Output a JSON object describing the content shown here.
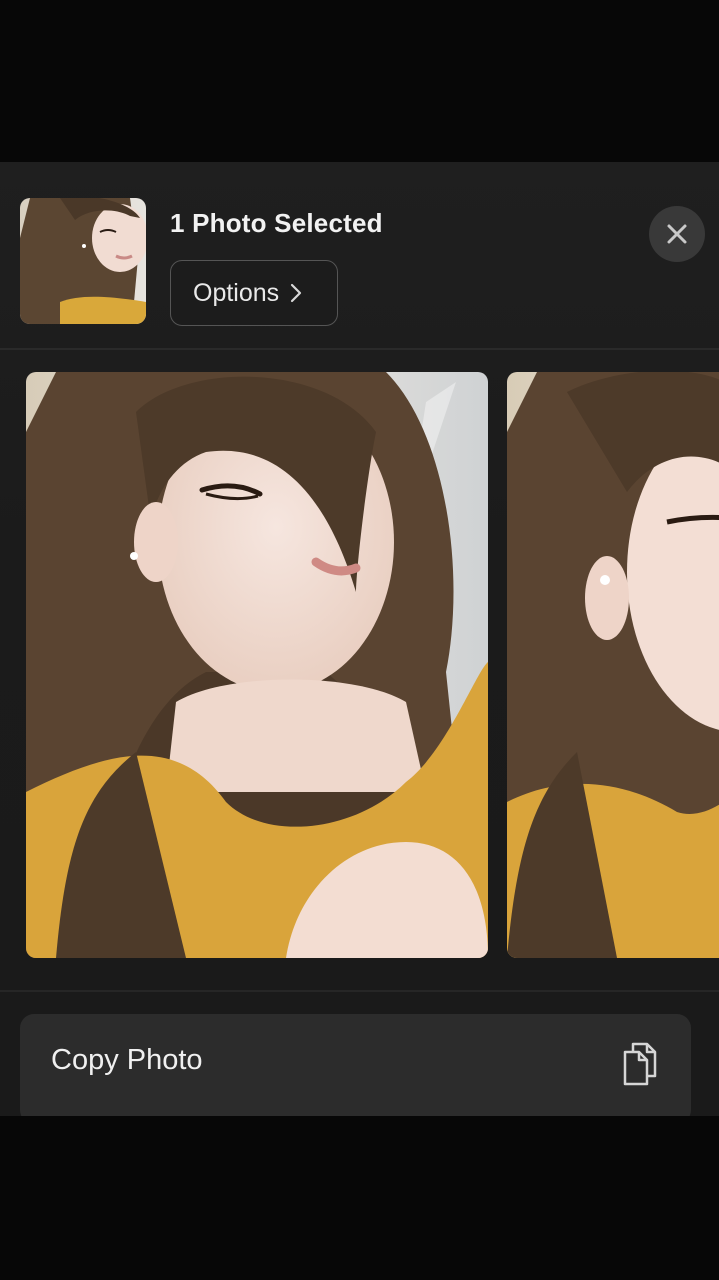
{
  "share_sheet": {
    "title": "1 Photo Selected",
    "options_label": "Options",
    "close_icon": "xmark-icon",
    "thumbnail_alt": "Selected photo thumbnail"
  },
  "carousel": {
    "photos": [
      {
        "description_icon": "photo-preview",
        "selected": true
      },
      {
        "description_icon": "photo-preview",
        "selected": false
      }
    ]
  },
  "actions": [
    {
      "label": "Copy Photo",
      "icon": "copy-icon"
    }
  ],
  "colors": {
    "sheet_background": "#1c1c1c",
    "action_background": "#2c2c2c",
    "close_background": "#393939",
    "text_primary": "#f2f2f2"
  }
}
